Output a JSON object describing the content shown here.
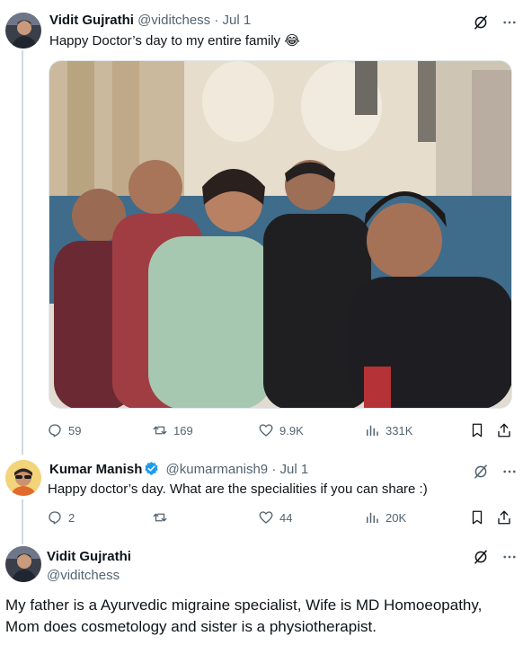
{
  "tweet1": {
    "name": "Vidit Gujrathi",
    "handle": "@viditchess",
    "dot": "·",
    "date": "Jul 1",
    "text": "Happy Doctor’s day to my entire family 😂",
    "stats": {
      "replies": "59",
      "retweets": "169",
      "likes": "9.9K",
      "views": "331K"
    }
  },
  "tweet2": {
    "name": "Kumar Manish",
    "handle": "@kumarmanish9",
    "dot": "·",
    "date": "Jul 1",
    "text": "Happy doctor’s day. What are the specialities if you can share :)",
    "stats": {
      "replies": "2",
      "retweets": "",
      "likes": "44",
      "views": "20K"
    }
  },
  "tweet3": {
    "name": "Vidit Gujrathi",
    "handle": "@viditchess",
    "text": "My father is a Ayurvedic migraine specialist, Wife is MD Homoeopathy, Mom does cosmetology and sister is a physiotherapist."
  },
  "colors": {
    "text": "#0f1419",
    "secondary": "#536471",
    "verified": "#1d9bf0",
    "thread_line": "#cfd9de"
  }
}
